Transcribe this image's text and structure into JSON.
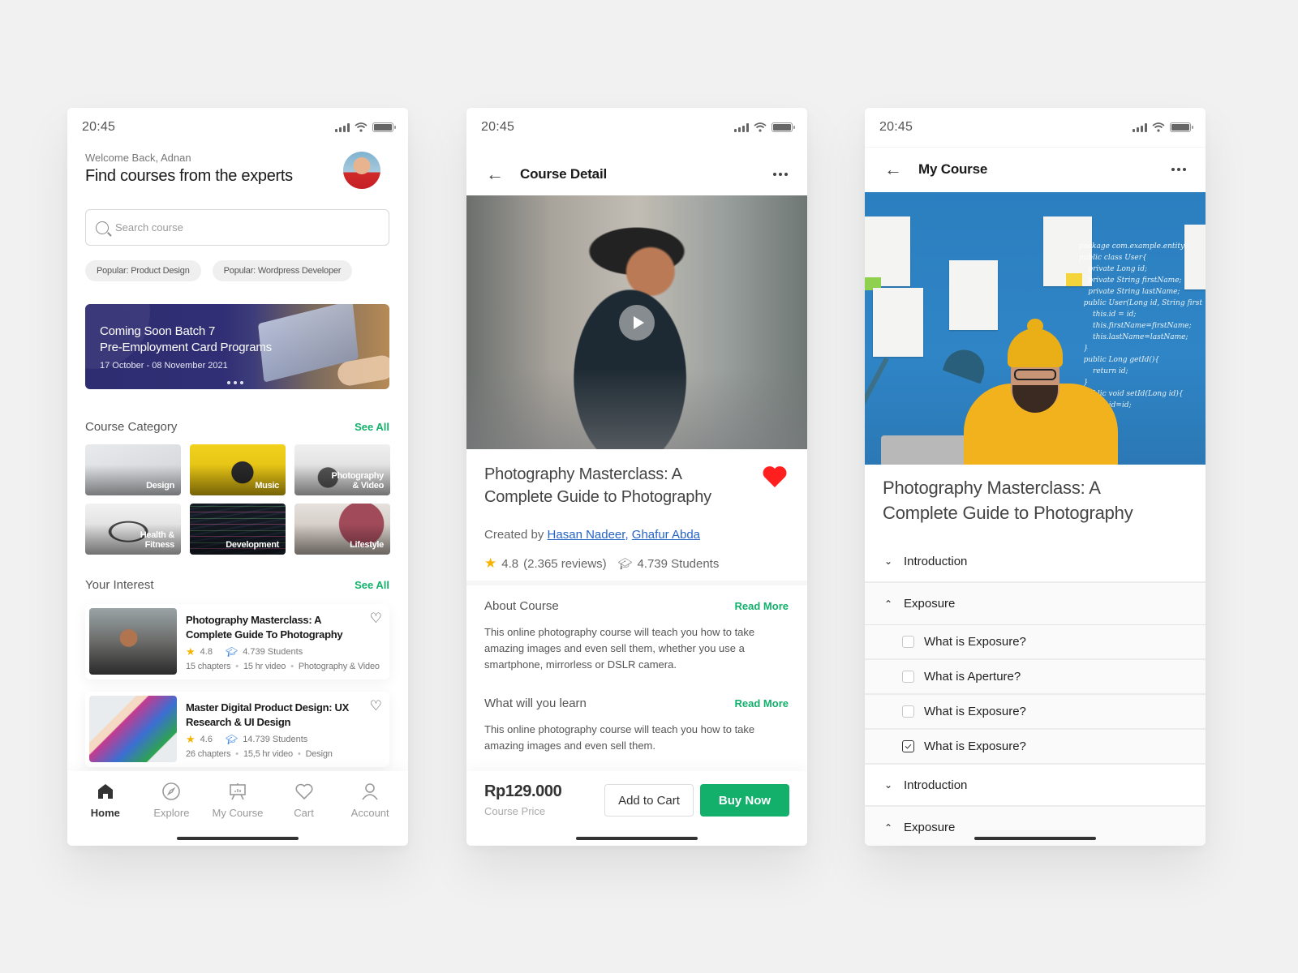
{
  "status_bar": {
    "time": "20:45"
  },
  "home": {
    "welcome": "Welcome Back, Adnan",
    "headline": "Find courses from the experts",
    "search": {
      "placeholder": "Search course",
      "value": ""
    },
    "chips": [
      "Popular: Product Design",
      "Popular: Wordpress Developer"
    ],
    "banner": {
      "title_line1": "Coming Soon Batch 7",
      "title_line2": "Pre-Employment Card Programs",
      "date": "17 October - 08 November 2021",
      "pages": 3
    },
    "category_section": {
      "title": "Course Category",
      "see_all": "See All"
    },
    "categories": [
      {
        "label": "Design"
      },
      {
        "label": "Music"
      },
      {
        "label_line1": "Photography",
        "label_line2": "& Video"
      },
      {
        "label_line1": "Health &",
        "label_line2": "Fitness"
      },
      {
        "label": "Development"
      },
      {
        "label": "Lifestyle"
      }
    ],
    "interest_section": {
      "title": "Your Interest",
      "see_all": "See All"
    },
    "courses": [
      {
        "title": "Photography Masterclass: A Complete Guide To Photography",
        "rating": "4.8",
        "students": "4.739 Students",
        "chapters": "15 chapters",
        "video": "15 hr video",
        "category": "Photography & Video"
      },
      {
        "title": "Master Digital Product Design: UX Research & UI Design",
        "rating": "4.6",
        "students": "14.739 Students",
        "chapters": "26 chapters",
        "video": "15,5 hr video",
        "category": "Design"
      }
    ],
    "tabs": [
      {
        "label": "Home",
        "icon": "home-icon",
        "active": true
      },
      {
        "label": "Explore",
        "icon": "compass-icon",
        "active": false
      },
      {
        "label": "My Course",
        "icon": "presentation-board-icon",
        "active": false
      },
      {
        "label": "Cart",
        "icon": "heart-icon",
        "active": false
      },
      {
        "label": "Account",
        "icon": "user-icon",
        "active": false
      }
    ]
  },
  "detail": {
    "nav_title": "Course Detail",
    "course_title": "Photography Masterclass: A Complete Guide to Photography",
    "favorited": true,
    "created_by_label": "Created by",
    "authors": [
      "Hasan Nadeer,",
      "Ghafur Abda"
    ],
    "rating": "4.8",
    "reviews": "(2.365 reviews)",
    "students": "4.739 Students",
    "about": {
      "title": "About Course",
      "read_more": "Read More",
      "text": "This online photography course will teach you how to take amazing images and even sell them, whether you use a smartphone, mirrorless or DSLR camera."
    },
    "learn": {
      "title": "What will you learn",
      "read_more": "Read More",
      "text": "This online photography course will teach you how to take amazing images and even sell them."
    },
    "price": "Rp129.000",
    "price_label": "Course Price",
    "add_to_cart": "Add to Cart",
    "buy_now": "Buy Now"
  },
  "my_course": {
    "nav_title": "My Course",
    "course_title": "Photography Masterclass: A Complete Guide to Photography",
    "sections": [
      {
        "label": "Introduction",
        "expanded": false
      },
      {
        "label": "Exposure",
        "expanded": true,
        "lessons": [
          {
            "label": "What is Exposure?",
            "done": false
          },
          {
            "label": "What is Aperture?",
            "done": false
          },
          {
            "label": "What is Exposure?",
            "done": false
          },
          {
            "label": "What is Exposure?",
            "done": true
          }
        ]
      },
      {
        "label": "Introduction",
        "expanded": false
      },
      {
        "label": "Exposure",
        "expanded": true
      }
    ]
  },
  "colors": {
    "accent_green": "#12b06b",
    "link_blue": "#2563c7",
    "heart_red": "#ff1f1f",
    "star_yellow": "#f5b400",
    "banner_indigo": "#2f2d72"
  }
}
